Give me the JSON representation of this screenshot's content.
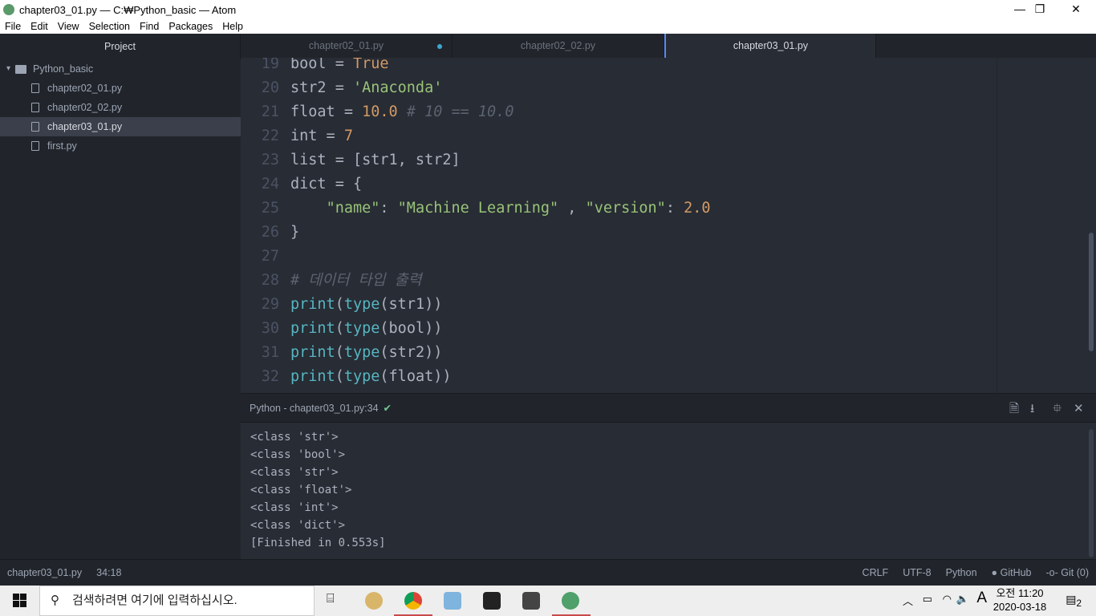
{
  "window": {
    "title": "chapter03_01.py — C:₩Python_basic — Atom",
    "minimize": "—",
    "maximize": "❐",
    "close": "✕"
  },
  "menu": [
    "File",
    "Edit",
    "View",
    "Selection",
    "Find",
    "Packages",
    "Help"
  ],
  "sidebar": {
    "header": "Project",
    "folder": "Python_basic",
    "files": [
      "chapter02_01.py",
      "chapter02_02.py",
      "chapter03_01.py",
      "first.py"
    ],
    "selected": "chapter03_01.py"
  },
  "tabs": [
    {
      "label": "chapter02_01.py",
      "modified": true
    },
    {
      "label": "chapter02_02.py"
    },
    {
      "label": "chapter03_01.py",
      "active": true
    }
  ],
  "code": [
    {
      "n": "19",
      "t": [
        [
          "p",
          "bool = "
        ],
        [
          "n",
          "True"
        ]
      ]
    },
    {
      "n": "20",
      "t": [
        [
          "p",
          "str2 = "
        ],
        [
          "s",
          "'Anaconda'"
        ]
      ]
    },
    {
      "n": "21",
      "t": [
        [
          "p",
          "float = "
        ],
        [
          "n",
          "10.0"
        ],
        [
          "p",
          " "
        ],
        [
          "c",
          "# 10 == 10.0"
        ]
      ]
    },
    {
      "n": "22",
      "t": [
        [
          "p",
          "int = "
        ],
        [
          "n",
          "7"
        ]
      ]
    },
    {
      "n": "23",
      "t": [
        [
          "p",
          "list = [str1, str2]"
        ]
      ]
    },
    {
      "n": "24",
      "t": [
        [
          "p",
          "dict = {"
        ]
      ]
    },
    {
      "n": "25",
      "t": [
        [
          "p",
          "    "
        ],
        [
          "s",
          "\"name\""
        ],
        [
          "p",
          ": "
        ],
        [
          "s",
          "\"Machine Learning\""
        ],
        [
          "p",
          " , "
        ],
        [
          "s",
          "\"version\""
        ],
        [
          "p",
          ": "
        ],
        [
          "n",
          "2.0"
        ]
      ]
    },
    {
      "n": "26",
      "t": [
        [
          "p",
          "}"
        ]
      ]
    },
    {
      "n": "27",
      "t": []
    },
    {
      "n": "28",
      "t": [
        [
          "c",
          "# 데이터 타입 출력"
        ]
      ]
    },
    {
      "n": "29",
      "t": [
        [
          "f",
          "print"
        ],
        [
          "p",
          "("
        ],
        [
          "f",
          "type"
        ],
        [
          "p",
          "(str1))"
        ]
      ]
    },
    {
      "n": "30",
      "t": [
        [
          "f",
          "print"
        ],
        [
          "p",
          "("
        ],
        [
          "f",
          "type"
        ],
        [
          "p",
          "(bool))"
        ]
      ]
    },
    {
      "n": "31",
      "t": [
        [
          "f",
          "print"
        ],
        [
          "p",
          "("
        ],
        [
          "f",
          "type"
        ],
        [
          "p",
          "(str2))"
        ]
      ]
    },
    {
      "n": "32",
      "t": [
        [
          "f",
          "print"
        ],
        [
          "p",
          "("
        ],
        [
          "f",
          "type"
        ],
        [
          "p",
          "(float))"
        ]
      ]
    }
  ],
  "panel": {
    "title": "Python - chapter03_01.py:34",
    "status": "✔"
  },
  "output": [
    "<class 'str'>",
    "<class 'bool'>",
    "<class 'str'>",
    "<class 'float'>",
    "<class 'int'>",
    "<class 'dict'>",
    "[Finished in 0.553s]"
  ],
  "status": {
    "file": "chapter03_01.py",
    "cursor": "34:18",
    "line_ending": "CRLF",
    "encoding": "UTF-8",
    "grammar": "Python",
    "github": "GitHub",
    "git": "Git (0)"
  },
  "taskbar": {
    "search_placeholder": "검색하려면 여기에 입력하십시오.",
    "time": "오전 11:20",
    "date": "2020-03-18",
    "ime": "A",
    "notifications": "2"
  },
  "colors": {
    "bg": "#282c34",
    "sidebar": "#21252b",
    "number": "#d19a66",
    "string": "#98c379",
    "function": "#56b6c2",
    "comment": "#5c6370",
    "accent": "#568af2"
  }
}
